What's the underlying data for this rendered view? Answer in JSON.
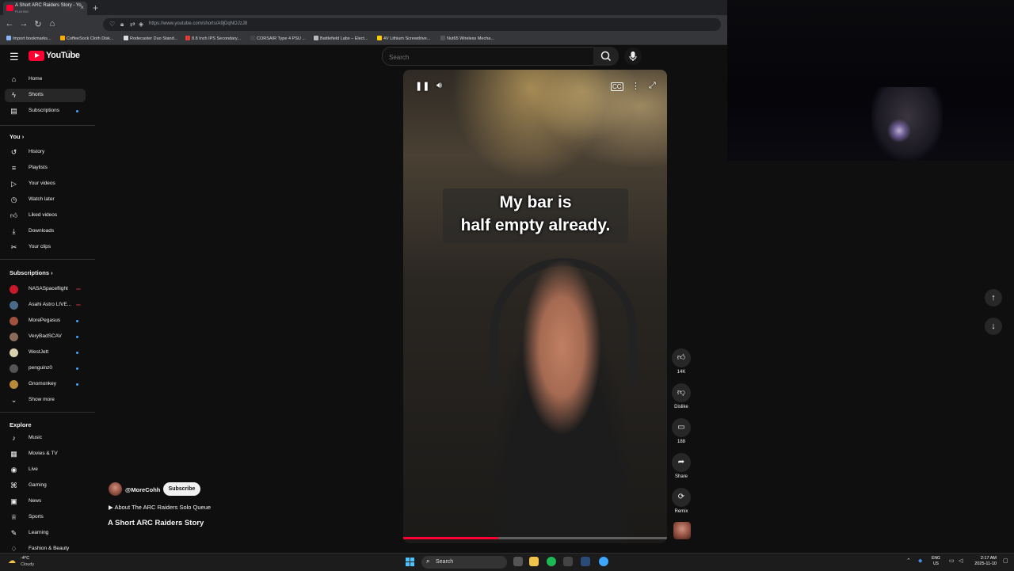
{
  "browser": {
    "tab_title": "A Short ARC Raiders Story - Yo",
    "tab_status": "PLAYING",
    "url": "https://www.youtube.com/shorts/A9jDqNOJzJ8",
    "bookmarks": [
      "Import bookmarks...",
      "CoffeeSock Cloth Disk...",
      "Rodecaster Duo Stand...",
      "8.8 Inch IPS Secondary...",
      "CORSAIR Type 4 PSU ...",
      "Battlefield Labs – Elect...",
      "4V Lithium Screwdrive...",
      "Nut65 Wireless Mecha..."
    ]
  },
  "header": {
    "logo": "YouTube",
    "country": "CA",
    "search_placeholder": "Search"
  },
  "sidebar": {
    "main": [
      {
        "label": "Home",
        "icon": "home-icon"
      },
      {
        "label": "Shorts",
        "icon": "shorts-icon",
        "active": true
      },
      {
        "label": "Subscriptions",
        "icon": "subscriptions-icon"
      }
    ],
    "you_title": "You",
    "you_items": [
      {
        "label": "History",
        "icon": "history-icon"
      },
      {
        "label": "Playlists",
        "icon": "playlists-icon"
      },
      {
        "label": "Your videos",
        "icon": "your-videos-icon"
      },
      {
        "label": "Watch later",
        "icon": "watch-later-icon"
      },
      {
        "label": "Liked videos",
        "icon": "liked-videos-icon"
      },
      {
        "label": "Downloads",
        "icon": "downloads-icon"
      },
      {
        "label": "Your clips",
        "icon": "clips-icon"
      }
    ],
    "subs_title": "Subscriptions",
    "subscriptions": [
      {
        "name": "NASASpaceflight",
        "badge": "live",
        "color": "#c9182b"
      },
      {
        "name": "Asahi Astro LIVE...",
        "badge": "live",
        "color": "#4a6a8a"
      },
      {
        "name": "MorePegasus",
        "badge": "new",
        "color": "#a0523c"
      },
      {
        "name": "VeryBadSCAV",
        "badge": "new",
        "color": "#8a6a5a"
      },
      {
        "name": "WestJett",
        "badge": "new",
        "color": "#d9d0b0"
      },
      {
        "name": "penguinz0",
        "badge": "new",
        "color": "#555555"
      },
      {
        "name": "Gnomonkey",
        "badge": "new",
        "color": "#b88a3a"
      }
    ],
    "show_more": "Show more",
    "explore_title": "Explore",
    "explore_items": [
      {
        "label": "Music",
        "icon": "music-icon"
      },
      {
        "label": "Movies & TV",
        "icon": "movies-icon"
      },
      {
        "label": "Live",
        "icon": "live-icon"
      },
      {
        "label": "Gaming",
        "icon": "gaming-icon"
      },
      {
        "label": "News",
        "icon": "news-icon"
      },
      {
        "label": "Sports",
        "icon": "sports-icon"
      },
      {
        "label": "Learning",
        "icon": "learning-icon"
      },
      {
        "label": "Fashion & Beauty",
        "icon": "fashion-icon"
      }
    ]
  },
  "short": {
    "caption_line1": "My bar is",
    "caption_line2": "half empty already.",
    "progress_fraction": 0.36,
    "channel": "@MoreCohh",
    "subscribe_label": "Subscribe",
    "about": "About The ARC Raiders Solo Queue",
    "title": "A Short ARC Raiders Story",
    "actions": {
      "likes": "14K",
      "dislike": "Dislike",
      "comments": "188",
      "share": "Share",
      "remix": "Remix"
    }
  },
  "taskbar": {
    "weather_temp": "-4°C",
    "weather_desc": "Cloudy",
    "search_label": "Search",
    "lang_top": "ENG",
    "lang_bottom": "US",
    "time": "2:17 AM",
    "date": "2025-11-10"
  },
  "colors": {
    "accent": "#ff0033",
    "bg": "#0f0f0f",
    "badge_new": "#3ea6ff"
  }
}
